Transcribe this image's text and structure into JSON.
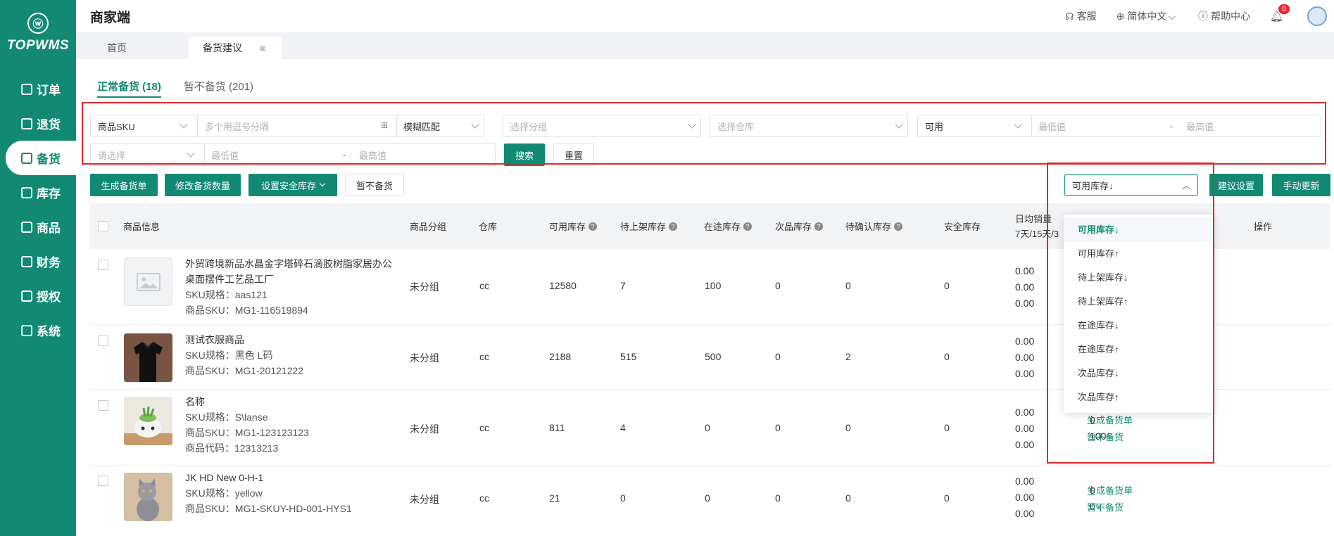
{
  "sidebar": {
    "logo_text": "TOPWMS",
    "items": [
      {
        "label": "订单"
      },
      {
        "label": "退货"
      },
      {
        "label": "备货",
        "active": true
      },
      {
        "label": "库存"
      },
      {
        "label": "商品"
      },
      {
        "label": "财务"
      },
      {
        "label": "授权"
      },
      {
        "label": "系统"
      }
    ]
  },
  "header": {
    "title": "商家端",
    "service": "客服",
    "language": "简体中文",
    "help": "帮助中心",
    "notifications": "0"
  },
  "page_tabs": [
    {
      "label": "首页"
    },
    {
      "label": "备货建议",
      "active": true
    }
  ],
  "sub_tabs": [
    {
      "label": "正常备货 (18)",
      "active": true
    },
    {
      "label": "暂不备货 (201)"
    }
  ],
  "filters": {
    "sku_type": "商品SKU",
    "sku_placeholder": "多个用逗号分隔",
    "match_mode": "模糊匹配",
    "group_placeholder": "选择分组",
    "warehouse_placeholder": "选择仓库",
    "stock_type": "可用",
    "min_placeholder": "最低值",
    "max_placeholder": "最高值",
    "select_placeholder": "请选择",
    "dash": "-",
    "search_label": "搜索",
    "reset_label": "重置"
  },
  "toolbar": {
    "generate": "生成备货单",
    "modify_qty": "修改备货数量",
    "safety_stock": "设置安全库存",
    "pause": "暂不备货",
    "sort_value": "可用库存↓",
    "suggest_settings": "建议设置",
    "manual_update": "手动更新"
  },
  "sort_options": [
    {
      "label": "可用库存↓",
      "active": true
    },
    {
      "label": "可用库存↑"
    },
    {
      "label": "待上架库存↓"
    },
    {
      "label": "待上架库存↑"
    },
    {
      "label": "在途库存↓"
    },
    {
      "label": "在途库存↑"
    },
    {
      "label": "次品库存↓"
    },
    {
      "label": "次品库存↑"
    }
  ],
  "table": {
    "headers": {
      "product_info": "商品信息",
      "group": "商品分组",
      "warehouse": "仓库",
      "available": "可用库存",
      "pending_shelf": "待上架库存",
      "in_transit": "在途库存",
      "defective": "次品库存",
      "to_confirm": "待确认库存",
      "safety": "安全库存",
      "daily_sales": "日均销量",
      "daily_sales_sub": "7天/15天/3",
      "action": "操作"
    },
    "actions": {
      "generate": "生成备货单",
      "pause": "暂不备货"
    },
    "rows": [
      {
        "name1": "外贸跨境新品水晶金字塔碎石滴胶树脂家居办公",
        "name2": "桌面摆件工艺品工厂",
        "spec": "SKU规格：aas121",
        "sku": "商品SKU：MG1-116519894",
        "group": "未分组",
        "warehouse": "cc",
        "available": "12580",
        "pending": "7",
        "transit": "100",
        "defective": "0",
        "confirm": "0",
        "safety": "0",
        "d1": "0.00",
        "d2": "0.00",
        "d3": "0.00"
      },
      {
        "name1": "测试衣服商品",
        "spec": "SKU规格：黑色 L码",
        "sku": "商品SKU：MG1-20121222",
        "group": "未分组",
        "warehouse": "cc",
        "available": "2188",
        "pending": "515",
        "transit": "500",
        "defective": "0",
        "confirm": "2",
        "safety": "0",
        "d1": "0.00",
        "d2": "0.00",
        "d3": "0.00"
      },
      {
        "name1": "名称",
        "spec": "SKU规格：S\\lanse",
        "sku": "商品SKU：MG1-123123123",
        "code": "商品代码：12313213",
        "group": "未分组",
        "warehouse": "cc",
        "available": "811",
        "pending": "4",
        "transit": "0",
        "defective": "0",
        "confirm": "0",
        "safety": "0",
        "d1": "0.00",
        "d2": "0.00",
        "d3": "0.00",
        "s1": "0",
        "s2": "100"
      },
      {
        "name1": "JK HD New 0-H-1",
        "spec": "SKU规格：yellow",
        "sku": "商品SKU：MG1-SKUY-HD-001-HYS1",
        "group": "未分组",
        "warehouse": "cc",
        "available": "21",
        "pending": "0",
        "transit": "0",
        "defective": "0",
        "confirm": "0",
        "safety": "0",
        "d1": "0.00",
        "d2": "0.00",
        "d3": "0.00",
        "s1": "0",
        "s2": "0"
      }
    ]
  }
}
